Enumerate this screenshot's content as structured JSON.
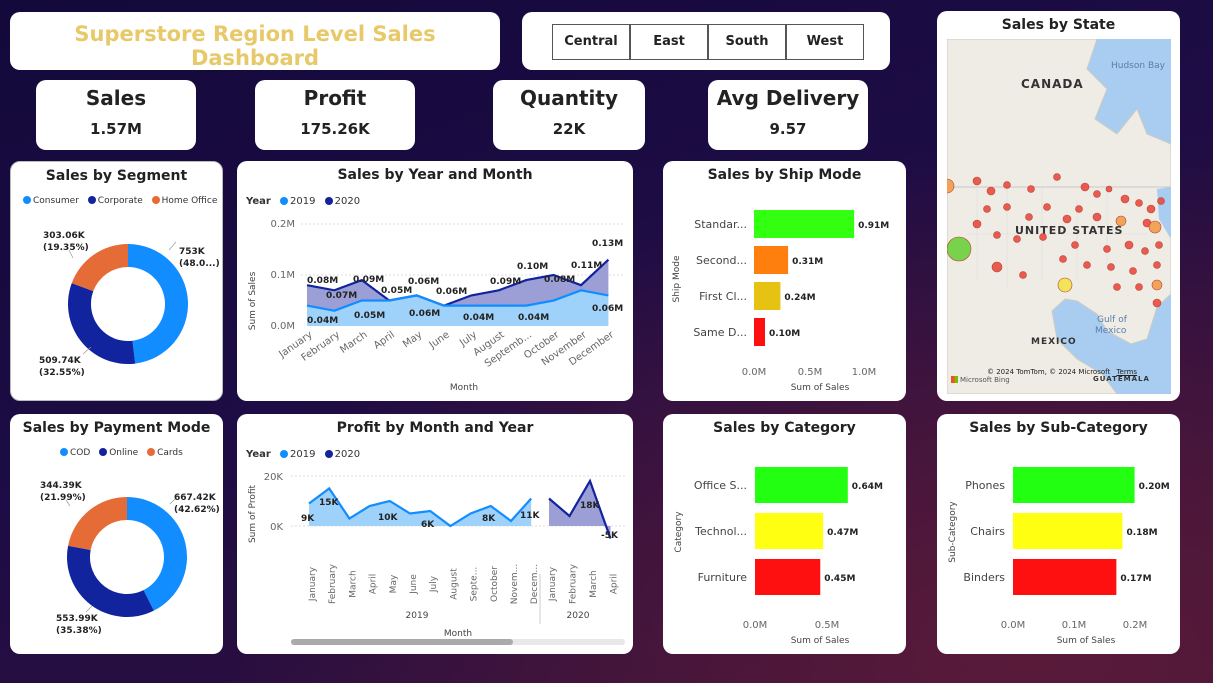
{
  "title": "Superstore Region Level Sales Dashboard",
  "regions": [
    "Central",
    "East",
    "South",
    "West"
  ],
  "kpis": [
    {
      "label": "Sales",
      "value": "1.57M"
    },
    {
      "label": "Profit",
      "value": "175.26K"
    },
    {
      "label": "Quantity",
      "value": "22K"
    },
    {
      "label": "Avg Delivery",
      "value": "9.57"
    }
  ],
  "segment": {
    "title": "Sales by Segment",
    "legend": [
      "Consumer",
      "Corporate",
      "Home Office"
    ],
    "labels": [
      "753K",
      "(48.0...)",
      "509.74K",
      "(32.55%)",
      "303.06K",
      "(19.35%)"
    ]
  },
  "payment": {
    "title": "Sales by Payment Mode",
    "legend": [
      "COD",
      "Online",
      "Cards"
    ],
    "labels": [
      "667.42K",
      "(42.62%)",
      "553.99K",
      "(35.38%)",
      "344.39K",
      "(21.99%)"
    ]
  },
  "yearmonth": {
    "title": "Sales by Year and Month",
    "legend_title": "Year",
    "legend": [
      "2019",
      "2020"
    ],
    "ylabel": "Sum of Sales",
    "xlabel": "Month",
    "yticks": [
      "0.2M",
      "0.1M",
      "0.0M"
    ],
    "months": [
      "January",
      "February",
      "March",
      "April",
      "May",
      "June",
      "July",
      "August",
      "Septemb...",
      "October",
      "November",
      "December"
    ],
    "labels_top": [
      "0.08M",
      "0.07M",
      "0.09M",
      "0.05M",
      "0.06M",
      "0.06M",
      "0.09M",
      "0.10M",
      "0.08M",
      "0.11M",
      "0.13M"
    ],
    "labels_bottom": [
      "0.04M",
      "0.05M",
      "0.06M",
      "0.04M",
      "0.04M",
      "0.06M"
    ]
  },
  "profitmonth": {
    "title": "Profit by Month and Year",
    "legend_title": "Year",
    "legend": [
      "2019",
      "2020"
    ],
    "ylabel": "Sum of Profit",
    "xlabel": "Month",
    "yticks": [
      "20K",
      "0K"
    ],
    "months2019": [
      "January",
      "February",
      "March",
      "April",
      "May",
      "June",
      "July",
      "August",
      "Septe...",
      "October",
      "Novem...",
      "Decem..."
    ],
    "months2020": [
      "January",
      "February",
      "March",
      "April"
    ],
    "year1": "2019",
    "year2": "2020",
    "labels": [
      "9K",
      "15K",
      "10K",
      "6K",
      "8K",
      "11K",
      "18K",
      "-5K"
    ]
  },
  "shipmode": {
    "title": "Sales by Ship Mode",
    "ylabel": "Ship Mode",
    "xlabel": "Sum of Sales",
    "xticks": [
      "0.0M",
      "0.5M",
      "1.0M"
    ],
    "cats": [
      "Standar...",
      "Second...",
      "First Cl...",
      "Same D..."
    ],
    "labels": [
      "0.91M",
      "0.31M",
      "0.24M",
      "0.10M"
    ]
  },
  "category": {
    "title": "Sales by Category",
    "ylabel": "Category",
    "xlabel": "Sum of Sales",
    "xticks": [
      "0.0M",
      "0.5M"
    ],
    "cats": [
      "Office S...",
      "Technol...",
      "Furniture"
    ],
    "labels": [
      "0.64M",
      "0.47M",
      "0.45M"
    ]
  },
  "subcategory": {
    "title": "Sales by Sub-Category",
    "ylabel": "Sub-Category",
    "xlabel": "Sum of Sales",
    "xticks": [
      "0.0M",
      "0.1M",
      "0.2M"
    ],
    "cats": [
      "Phones",
      "Chairs",
      "Binders"
    ],
    "labels": [
      "0.20M",
      "0.18M",
      "0.17M"
    ]
  },
  "map": {
    "title": "Sales by State",
    "labels": [
      "CANADA",
      "Hudson Bay",
      "UNITED STATES",
      "Gulf of",
      "Mexico",
      "MEXICO",
      "GUATEMALA"
    ],
    "credit": "© 2024 TomTom, © 2024 Microsoft",
    "terms": "Terms",
    "bing": "Microsoft Bing"
  },
  "chart_data": [
    {
      "type": "pie",
      "title": "Sales by Segment",
      "categories": [
        "Consumer",
        "Corporate",
        "Home Office"
      ],
      "values": [
        753000,
        509740,
        303060
      ],
      "colors": [
        "#118dff",
        "#12239e",
        "#e66c37"
      ]
    },
    {
      "type": "pie",
      "title": "Sales by Payment Mode",
      "categories": [
        "COD",
        "Online",
        "Cards"
      ],
      "values": [
        667420,
        553990,
        344390
      ],
      "colors": [
        "#118dff",
        "#12239e",
        "#e66c37"
      ]
    },
    {
      "type": "area",
      "title": "Sales by Year and Month",
      "categories": [
        "January",
        "February",
        "March",
        "April",
        "May",
        "June",
        "July",
        "August",
        "September",
        "October",
        "November",
        "December"
      ],
      "series": [
        {
          "name": "2019",
          "values": [
            0.04,
            0.03,
            0.05,
            0.05,
            0.06,
            0.04,
            0.04,
            0.04,
            0.04,
            0.05,
            0.07,
            0.06
          ],
          "color": "#118dff"
        },
        {
          "name": "2020",
          "values": [
            0.08,
            0.07,
            0.09,
            0.05,
            0.06,
            0.04,
            0.06,
            0.07,
            0.09,
            0.1,
            0.08,
            0.13
          ],
          "color": "#12239e"
        }
      ],
      "ylim": [
        0,
        0.2
      ],
      "unit": "M"
    },
    {
      "type": "area",
      "title": "Profit by Month and Year",
      "categories": [
        "January 2019",
        "February 2019",
        "March 2019",
        "April 2019",
        "May 2019",
        "June 2019",
        "July 2019",
        "August 2019",
        "September 2019",
        "October 2019",
        "November 2019",
        "December 2019",
        "January 2020",
        "February 2020",
        "March 2020",
        "April 2020"
      ],
      "series": [
        {
          "name": "2019",
          "values": [
            9,
            15,
            3,
            8,
            10,
            5,
            6,
            0,
            5,
            8,
            2,
            11
          ],
          "color": "#118dff"
        },
        {
          "name": "2020",
          "values": [
            11,
            4,
            18,
            -5
          ],
          "color": "#12239e"
        }
      ],
      "ylim": [
        -5,
        20
      ],
      "unit": "K"
    },
    {
      "type": "bar",
      "title": "Sales by Ship Mode",
      "categories": [
        "Standard Class",
        "Second Class",
        "First Class",
        "Same Day"
      ],
      "values": [
        0.91,
        0.31,
        0.24,
        0.1
      ],
      "colors": [
        "#33ff11",
        "#ff7f0e",
        "#e6c213",
        "#ff1010"
      ],
      "xlim": [
        0,
        1.0
      ],
      "unit": "M"
    },
    {
      "type": "bar",
      "title": "Sales by Category",
      "categories": [
        "Office Supplies",
        "Technology",
        "Furniture"
      ],
      "values": [
        0.64,
        0.47,
        0.45
      ],
      "colors": [
        "#22ff11",
        "#ffff11",
        "#ff1010"
      ],
      "xlim": [
        0,
        0.75
      ],
      "unit": "M"
    },
    {
      "type": "bar",
      "title": "Sales by Sub-Category",
      "categories": [
        "Phones",
        "Chairs",
        "Binders"
      ],
      "values": [
        0.2,
        0.18,
        0.17
      ],
      "colors": [
        "#22ff11",
        "#ffff11",
        "#ff1010"
      ],
      "xlim": [
        0,
        0.25
      ],
      "unit": "M"
    }
  ]
}
